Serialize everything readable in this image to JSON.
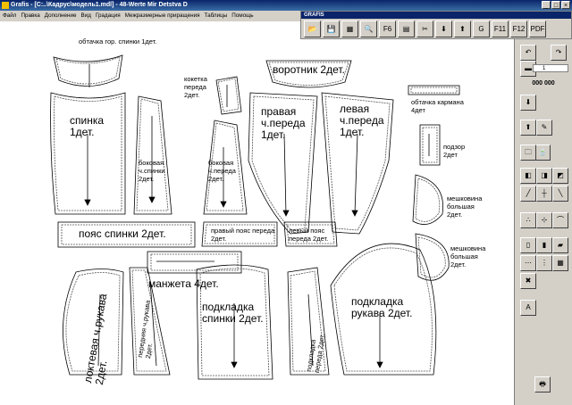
{
  "window": {
    "title": "Grafis - [C:..\\Кадрус\\модель1.mdl] - 48-Werte Mir Detstva D"
  },
  "menu": [
    "Файл",
    "Правка",
    "Дополнение",
    "Вид",
    "Градация",
    "Межразмерные приращения",
    "Таблицы",
    "Помощь"
  ],
  "toolbar": {
    "title": "GRAFIS",
    "buttons": [
      "open-icon",
      "save-icon",
      "new-icon",
      "search-icon",
      "f6-icon",
      "grid-icon",
      "cut-icon",
      "arrow-down-icon",
      "arrow-up-icon",
      "g-icon",
      "f11-icon",
      "f12-icon",
      "pdf-icon"
    ]
  },
  "sidebar": {
    "counter": "000 000",
    "spin_value": "1",
    "buttons": [
      "undo-icon",
      "redo-icon",
      "bar-icon",
      "marker-icon",
      "arrow-down-icon",
      "arrow-up-icon",
      "edit-icon",
      "cup-icon",
      "folder-icon",
      "shape-icon"
    ]
  },
  "labels": {
    "obtachka_spinki": "обтачка гор. спинки 1дет.",
    "vorotnik": "воротник 2дет.",
    "koketka": "кокетка переда 2дет.",
    "obtachka_karmana": "обтачка кармана 4дет",
    "spinka": "спинка 1дет.",
    "bokovaya_spinki": "боковая ч.спинки 2дет.",
    "bokovaya_pereda": "боковая ч.переда 2дет.",
    "pravaya_pereda": "правая ч.переда 1дет.",
    "levaya_pereda": "левая ч.переда 1дет.",
    "podzor": "подзор 2дет",
    "meshkovina_1": "мешковина большая 2дет.",
    "poyas_spinki": "пояс спинки 2дет.",
    "pravyi_poyas": "правый пояс переда 2дет.",
    "levyi_poyas": "левый пояс переда 2дет.",
    "meshkovina_2": "мешковина большая 2дет.",
    "manzheta": "манжета 4дет.",
    "loktevaya": "локтевая ч.рукава 2дет.",
    "perednyaya": "передняя ч.рукава 2дет.",
    "podkladka_spinki": "подкладка спинки 2дет.",
    "podkladka_pereda": "подкладка переда 2дет.",
    "podkladka_rukava": "подкладка рукава 2дет."
  }
}
